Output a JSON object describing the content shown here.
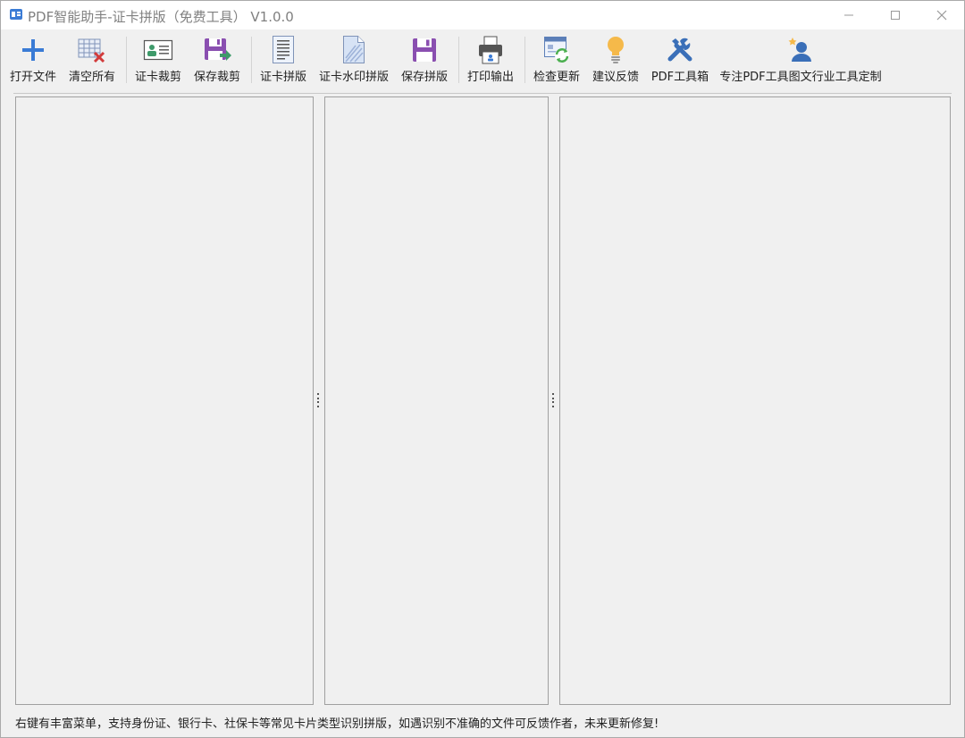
{
  "window": {
    "title": "PDF智能助手-证卡拼版（免费工具） V1.0.0"
  },
  "toolbar": {
    "items": [
      {
        "label": "打开文件",
        "icon": "plus-icon"
      },
      {
        "label": "清空所有",
        "icon": "clear-grid-icon"
      },
      {
        "label": "证卡裁剪",
        "icon": "id-card-icon"
      },
      {
        "label": "保存裁剪",
        "icon": "save-export-icon"
      },
      {
        "label": "证卡拼版",
        "icon": "document-layout-icon"
      },
      {
        "label": "证卡水印拼版",
        "icon": "watermark-document-icon"
      },
      {
        "label": "保存拼版",
        "icon": "save-icon"
      },
      {
        "label": "打印输出",
        "icon": "printer-icon"
      },
      {
        "label": "检查更新",
        "icon": "update-refresh-icon"
      },
      {
        "label": "建议反馈",
        "icon": "lightbulb-icon"
      },
      {
        "label": "PDF工具箱",
        "icon": "tools-icon"
      },
      {
        "label": "专注PDF工具图文行业工具定制",
        "icon": "user-star-icon"
      }
    ]
  },
  "status": {
    "text": "右键有丰富菜单，支持身份证、银行卡、社保卡等常见卡片类型识别拼版，如遇识别不准确的文件可反馈作者，未来更新修复!"
  },
  "colors": {
    "accent_blue": "#3a7bd5",
    "purple": "#8a4fb0",
    "bulb": "#f5b94a"
  }
}
